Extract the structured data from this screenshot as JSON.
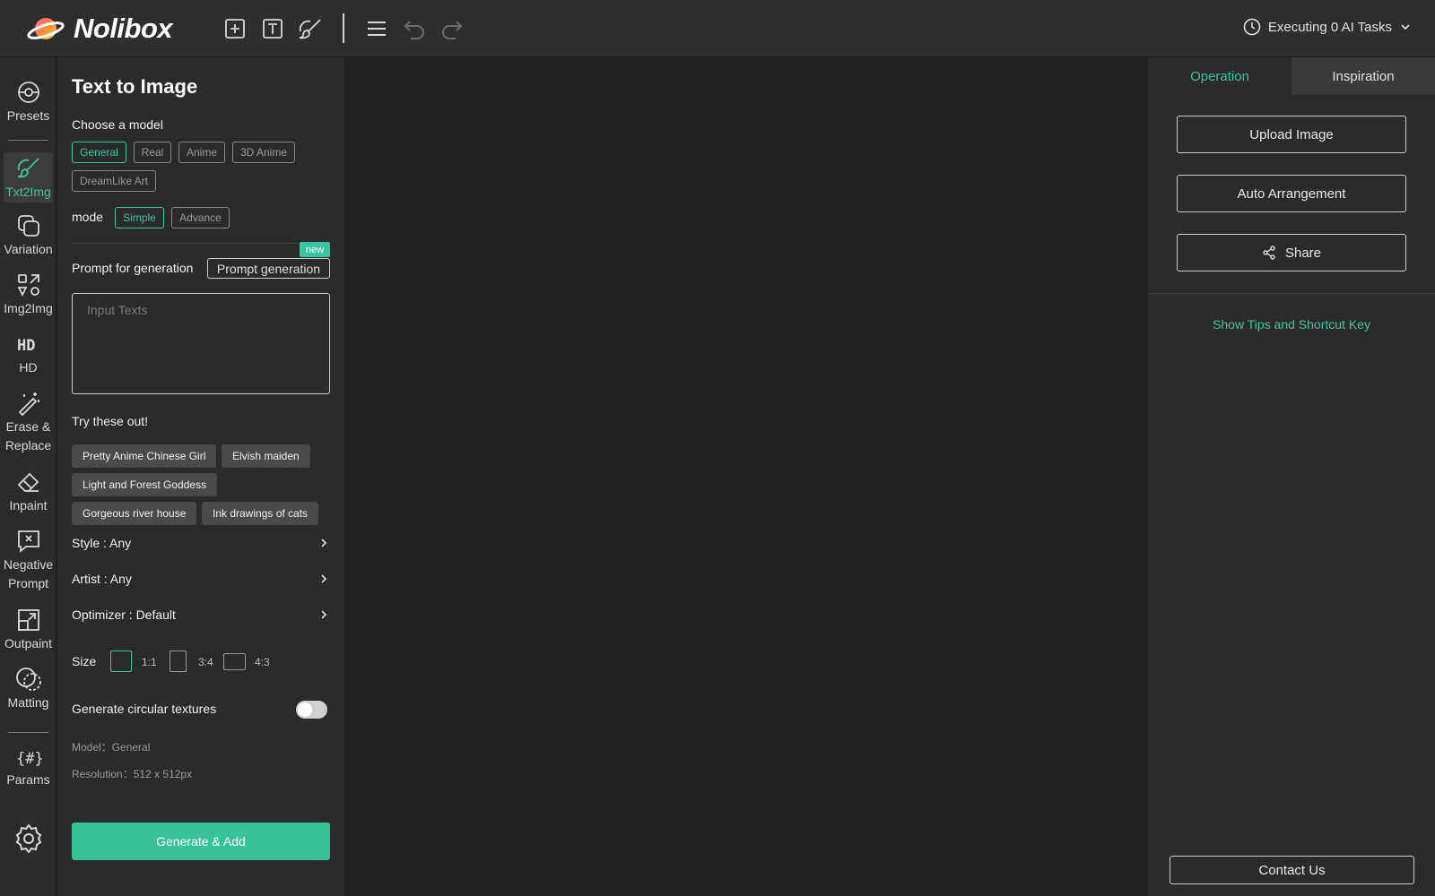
{
  "app": {
    "name": "Nolibox"
  },
  "header": {
    "icons": [
      "add-square-icon",
      "text-box-icon",
      "brush-icon",
      "menu-icon",
      "undo-icon",
      "redo-icon"
    ],
    "tasks_label": "Executing 0 AI Tasks"
  },
  "nav": {
    "items": [
      {
        "label": "Presets",
        "icon": "presets-icon"
      },
      {
        "label": "Txt2Img",
        "icon": "brush-icon",
        "active": true
      },
      {
        "label": "Variation",
        "icon": "variation-icon"
      },
      {
        "label": "Img2Img",
        "icon": "img2img-icon"
      },
      {
        "label": "HD",
        "icon": "hd-icon"
      },
      {
        "label": "Erase & Replace",
        "icon": "magic-wand-icon"
      },
      {
        "label": "Inpaint",
        "icon": "eraser-icon"
      },
      {
        "label": "Negative Prompt",
        "icon": "negative-prompt-icon"
      },
      {
        "label": "Outpaint",
        "icon": "outpaint-icon"
      },
      {
        "label": "Matting",
        "icon": "matting-icon"
      },
      {
        "label": "Params",
        "icon": "params-icon"
      }
    ],
    "settings_icon": "gear-icon"
  },
  "panel": {
    "title": "Text to Image",
    "model_label": "Choose a model",
    "models": [
      "General",
      "Real",
      "Anime",
      "3D Anime",
      "DreamLike Art"
    ],
    "selected_model": "General",
    "mode_label": "mode",
    "modes": [
      "Simple",
      "Advance"
    ],
    "selected_mode": "Simple",
    "new_badge": "new",
    "prompt_label": "Prompt for generation",
    "prompt_button": "Prompt generation",
    "prompt_placeholder": "Input Texts",
    "try_label": "Try these out!",
    "try_chips": [
      "Pretty Anime Chinese Girl",
      "Elvish maiden",
      "Light and Forest Goddess",
      "Gorgeous river house",
      "Ink drawings of cats"
    ],
    "style_label": "Style : Any",
    "artist_label": "Artist : Any",
    "optimizer_label": "Optimizer : Default",
    "size_label": "Size",
    "sizes": [
      "1:1",
      "3:4",
      "4:3"
    ],
    "selected_size": "1:1",
    "circular_label": "Generate circular textures",
    "circular_enabled": false,
    "model_info": "Model：General",
    "resolution_info": "Resolution：512 x 512px",
    "generate_button": "Generate & Add"
  },
  "right": {
    "tabs": [
      "Operation",
      "Inspiration"
    ],
    "active_tab": "Operation",
    "upload_button": "Upload Image",
    "arrange_button": "Auto Arrangement",
    "share_button": "Share",
    "tips_link": "Show Tips and Shortcut Key",
    "contact_button": "Contact Us"
  },
  "colors": {
    "accent": "#3dc4a0",
    "background": "#232323",
    "panel": "#2b2b2b"
  }
}
